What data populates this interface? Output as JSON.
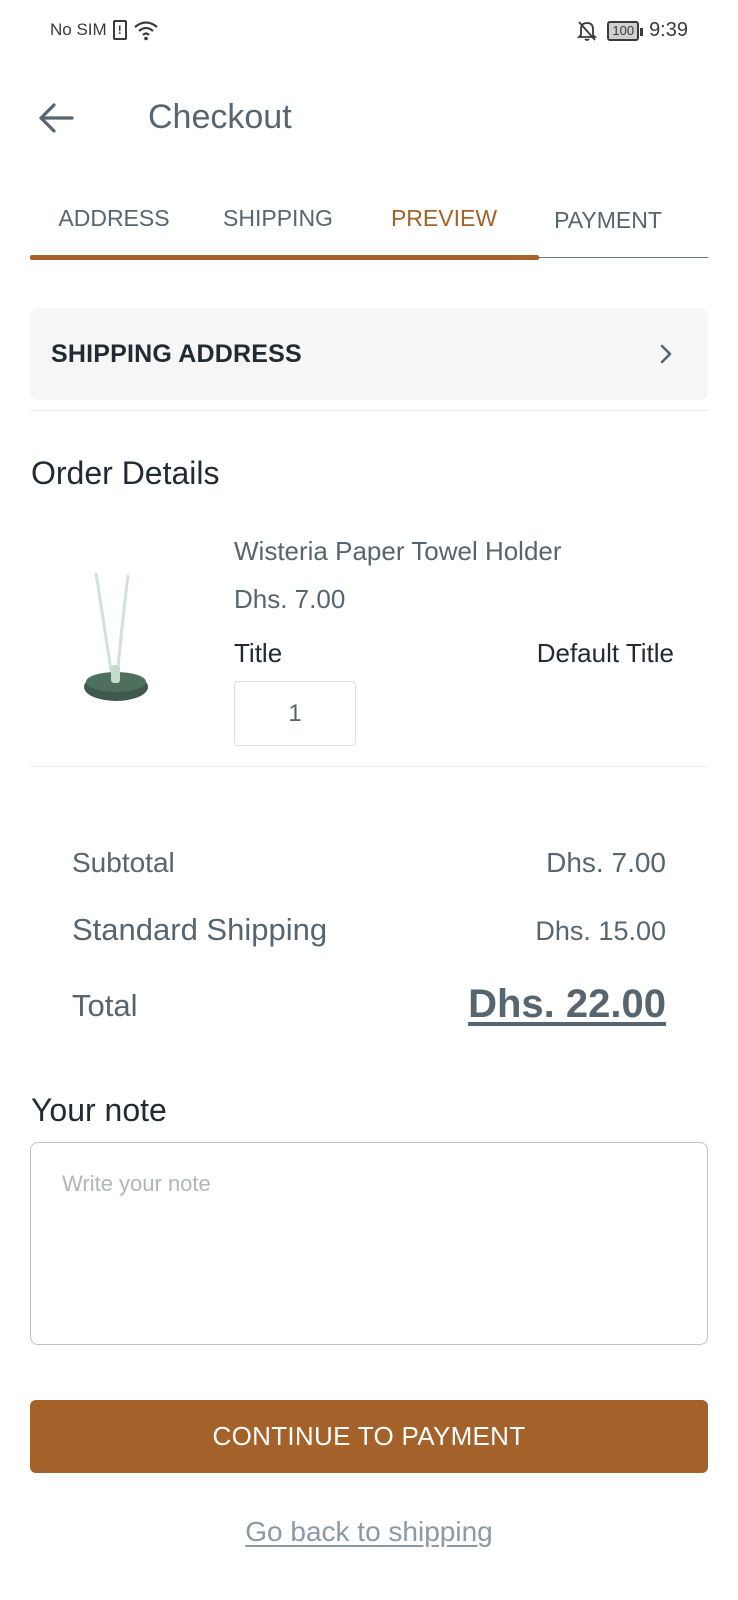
{
  "status_bar": {
    "carrier": "No SIM",
    "battery": "100",
    "time": "9:39"
  },
  "header": {
    "title": "Checkout"
  },
  "tabs": [
    {
      "label": "ADDRESS"
    },
    {
      "label": "SHIPPING"
    },
    {
      "label": "PREVIEW"
    },
    {
      "label": "PAYMENT"
    }
  ],
  "tabs_progress": 0.75,
  "shipping_address": {
    "label": "SHIPPING ADDRESS"
  },
  "order_details": {
    "title": "Order Details",
    "item": {
      "name": "Wisteria Paper Towel Holder",
      "price": "Dhs. 7.00",
      "option_label": "Title",
      "option_value": "Default Title",
      "quantity": "1"
    }
  },
  "summary": {
    "subtotal_label": "Subtotal",
    "subtotal_value": "Dhs. 7.00",
    "shipping_label": "Standard Shipping",
    "shipping_value": "Dhs. 15.00",
    "total_label": "Total",
    "total_value": "Dhs. 22.00"
  },
  "note": {
    "title": "Your note",
    "placeholder": "Write your note"
  },
  "actions": {
    "continue_label": "CONTINUE TO PAYMENT",
    "back_link": "Go back to shipping"
  },
  "colors": {
    "accent": "#a5612a",
    "text_muted": "#56656f",
    "link": "#8a99a6"
  },
  "icons": [
    "sim-alert-icon",
    "wifi-icon",
    "bell-off-icon",
    "battery-icon",
    "back-arrow-icon",
    "chevron-right-icon"
  ]
}
